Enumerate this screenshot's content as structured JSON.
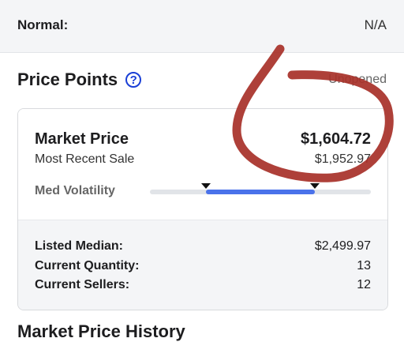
{
  "top_panel": {
    "label": "Normal:",
    "value": "N/A"
  },
  "price_points": {
    "title": "Price Points",
    "help_icon": "question-circle-icon",
    "condition": "Unopened",
    "market_price": {
      "label": "Market Price",
      "value": "$1,604.72"
    },
    "most_recent_sale": {
      "label": "Most Recent Sale",
      "value": "$1,952.97"
    },
    "volatility": {
      "label": "Med Volatility",
      "level": "medium"
    },
    "listed_median": {
      "label": "Listed Median:",
      "value": "$2,499.97"
    },
    "current_quantity": {
      "label": "Current Quantity:",
      "value": "13"
    },
    "current_sellers": {
      "label": "Current Sellers:",
      "value": "12"
    }
  },
  "next_section": {
    "title": "Market Price History"
  },
  "colors": {
    "accent": "#1a3fd6",
    "volatility_fill": "#4a72ea",
    "annotation": "#a8322a"
  }
}
